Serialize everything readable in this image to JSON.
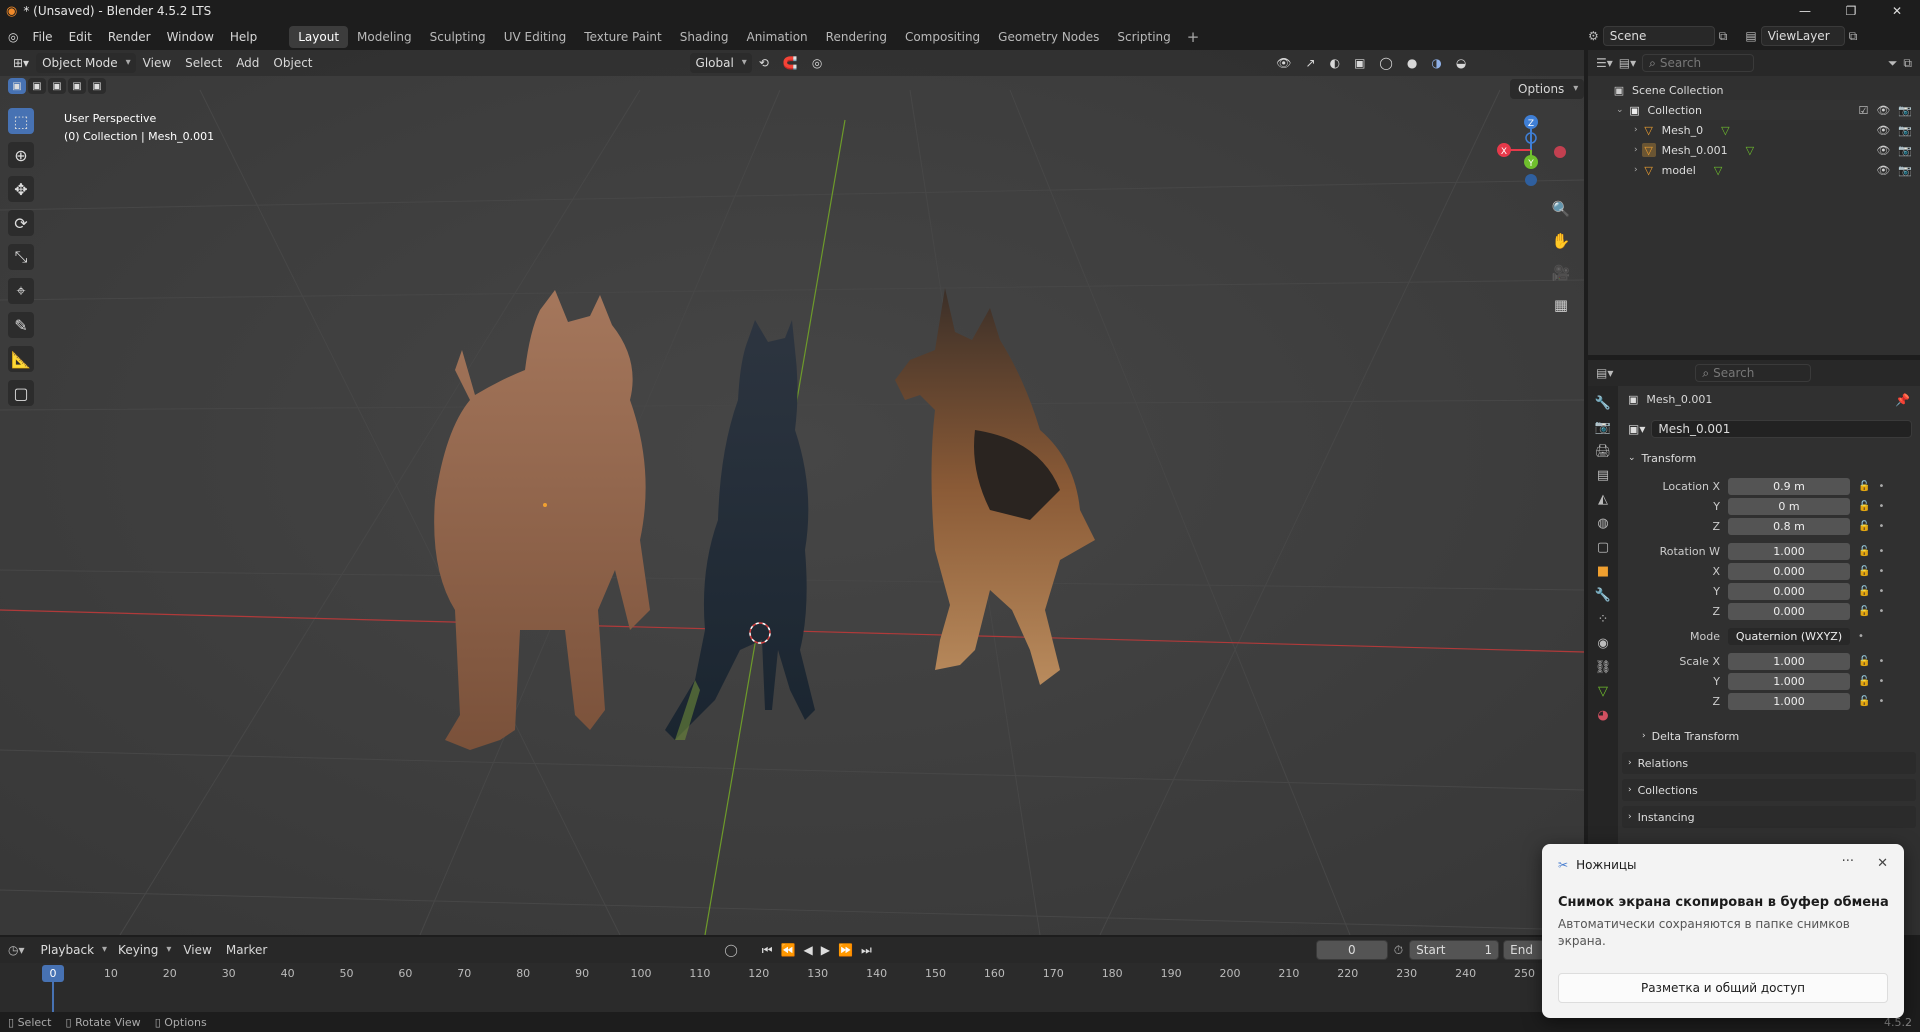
{
  "titlebar": {
    "title": "* (Unsaved) - Blender 4.5.2 LTS",
    "min": "—",
    "max": "❐",
    "close": "✕"
  },
  "menu": {
    "items": [
      "File",
      "Edit",
      "Render",
      "Window",
      "Help"
    ]
  },
  "workspaces": [
    "Layout",
    "Modeling",
    "Sculpting",
    "UV Editing",
    "Texture Paint",
    "Shading",
    "Animation",
    "Rendering",
    "Compositing",
    "Geometry Nodes",
    "Scripting"
  ],
  "workspace_add": "+",
  "scene": {
    "label": "Scene",
    "viewlayer": "ViewLayer"
  },
  "viewport": {
    "mode": "Object Mode",
    "menus": [
      "View",
      "Select",
      "Add",
      "Object"
    ],
    "orientation": "Global",
    "perspective": "User Perspective",
    "collection_info": "(0) Collection | Mesh_0.001",
    "options": "Options",
    "axes": {
      "x": "X",
      "y": "Y",
      "z": "Z"
    }
  },
  "outliner": {
    "search_placeholder": "Search",
    "scene_collection": "Scene Collection",
    "collection": "Collection",
    "objects": [
      "Mesh_0",
      "Mesh_0.001",
      "model"
    ]
  },
  "properties": {
    "search_placeholder": "Search",
    "object_name": "Mesh_0.001",
    "datablock": "Mesh_0.001",
    "transform": "Transform",
    "location_label": "Location X",
    "loc": {
      "x": "0.9 m",
      "y": "0 m",
      "z": "0.8 m"
    },
    "rotation_label": "Rotation W",
    "rot": {
      "w": "1.000",
      "x": "0.000",
      "y": "0.000",
      "z": "0.000"
    },
    "mode_label": "Mode",
    "mode": "Quaternion (WXYZ)",
    "scale_label": "Scale X",
    "scale": {
      "x": "1.000",
      "y": "1.000",
      "z": "1.000"
    },
    "y": "Y",
    "z": "Z",
    "x": "X",
    "delta": "Delta Transform",
    "sections": [
      "Relations",
      "Collections",
      "Instancing"
    ]
  },
  "timeline": {
    "menus": [
      "Playback",
      "Keying",
      "View",
      "Marker"
    ],
    "current_frame": "0",
    "start_label": "Start",
    "start": "1",
    "end_label": "End",
    "ticks": [
      "0",
      "10",
      "20",
      "30",
      "40",
      "50",
      "60",
      "70",
      "80",
      "90",
      "100",
      "110",
      "120",
      "130",
      "140",
      "150",
      "160",
      "170",
      "180",
      "190",
      "200",
      "210",
      "220",
      "230",
      "240",
      "250"
    ]
  },
  "status": {
    "select": "Select",
    "rotate": "Rotate View",
    "options": "Options",
    "version": "4.5.2"
  },
  "toast": {
    "app": "Ножницы",
    "heading": "Снимок экрана скопирован в буфер обмена",
    "body": "Автоматически сохраняются в папке снимков экрана.",
    "button": "Разметка и общий доступ",
    "more": "···",
    "close": "✕"
  },
  "colors": {
    "accent": "#4772b3",
    "x_axis": "#e6394a",
    "y_axis": "#6fbf2d",
    "z_axis": "#3f7fd6",
    "active_object": "#f0a030"
  }
}
